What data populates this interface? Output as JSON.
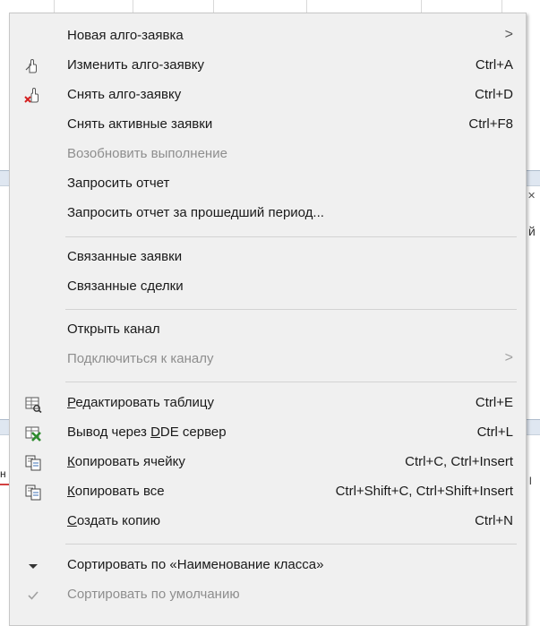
{
  "menu": {
    "items": [
      {
        "label": "Новая алго-заявка",
        "shortcut": "",
        "submenu": ">",
        "icon": "algo-order-icon"
      },
      {
        "label": "Изменить алго-заявку",
        "shortcut": "Ctrl+A",
        "icon": "hand-edit-icon"
      },
      {
        "label": "Снять алго-заявку",
        "shortcut": "Ctrl+D",
        "icon": "hand-cancel-icon"
      },
      {
        "label": "Снять активные заявки",
        "shortcut": "Ctrl+F8"
      },
      {
        "label": "Возобновить выполнение",
        "shortcut": "",
        "disabled": true
      },
      {
        "label": "Запросить отчет",
        "shortcut": ""
      },
      {
        "label": "Запросить отчет за прошедший период...",
        "shortcut": ""
      },
      {
        "label": "Связанные заявки",
        "shortcut": ""
      },
      {
        "label": "Связанные сделки",
        "shortcut": ""
      },
      {
        "label": "Открыть канал",
        "shortcut": ""
      },
      {
        "label": "Подключиться к каналу",
        "submenu": ">",
        "disabled": true
      },
      {
        "label_pre": "",
        "label_u": "Р",
        "label_post": "едактировать таблицу",
        "shortcut": "Ctrl+E",
        "icon": "edit-table-icon"
      },
      {
        "label_pre": "Вывод через ",
        "label_u": "D",
        "label_post": "DE сервер",
        "shortcut": "Ctrl+L",
        "icon": "dde-export-icon"
      },
      {
        "label_pre": "",
        "label_u": "К",
        "label_post": "опировать ячейку",
        "shortcut": "Ctrl+C, Ctrl+Insert",
        "icon": "copy-icon"
      },
      {
        "label_pre": "",
        "label_u": "К",
        "label_post": "опировать все",
        "shortcut": "Ctrl+Shift+C, Ctrl+Shift+Insert",
        "icon": "copy-icon"
      },
      {
        "label_pre": "",
        "label_u": "С",
        "label_post": "оздать копию",
        "shortcut": "Ctrl+N"
      },
      {
        "label": "Сортировать по «Наименование класса»",
        "shortcut": "",
        "icon": "sort-desc-icon"
      },
      {
        "label": "Сортировать по умолчанию",
        "shortcut": "",
        "disabled": true,
        "icon": "checkmark-icon"
      }
    ]
  },
  "background": {
    "left_fragment": "н",
    "right_fragment_top": "й",
    "right_fragment_bottom": "l"
  },
  "colors": {
    "menu_bg": "#f0f0f0",
    "disabled_text": "#8e8e8e",
    "icon_red": "#d32020",
    "icon_green": "#2e8b2e"
  }
}
